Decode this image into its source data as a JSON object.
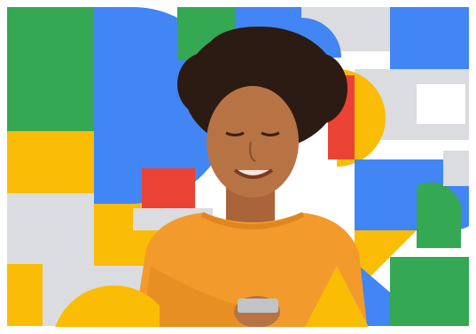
{
  "image": {
    "alt": "",
    "palette": {
      "green": "#34a853",
      "blue": "#4285f4",
      "yellow": "#fbbc05",
      "red": "#ea4335",
      "light_gray": "#dadce0",
      "orange_sweater": "#f39a2c",
      "skin": "#b87345",
      "hair": "#2b1b12"
    }
  }
}
